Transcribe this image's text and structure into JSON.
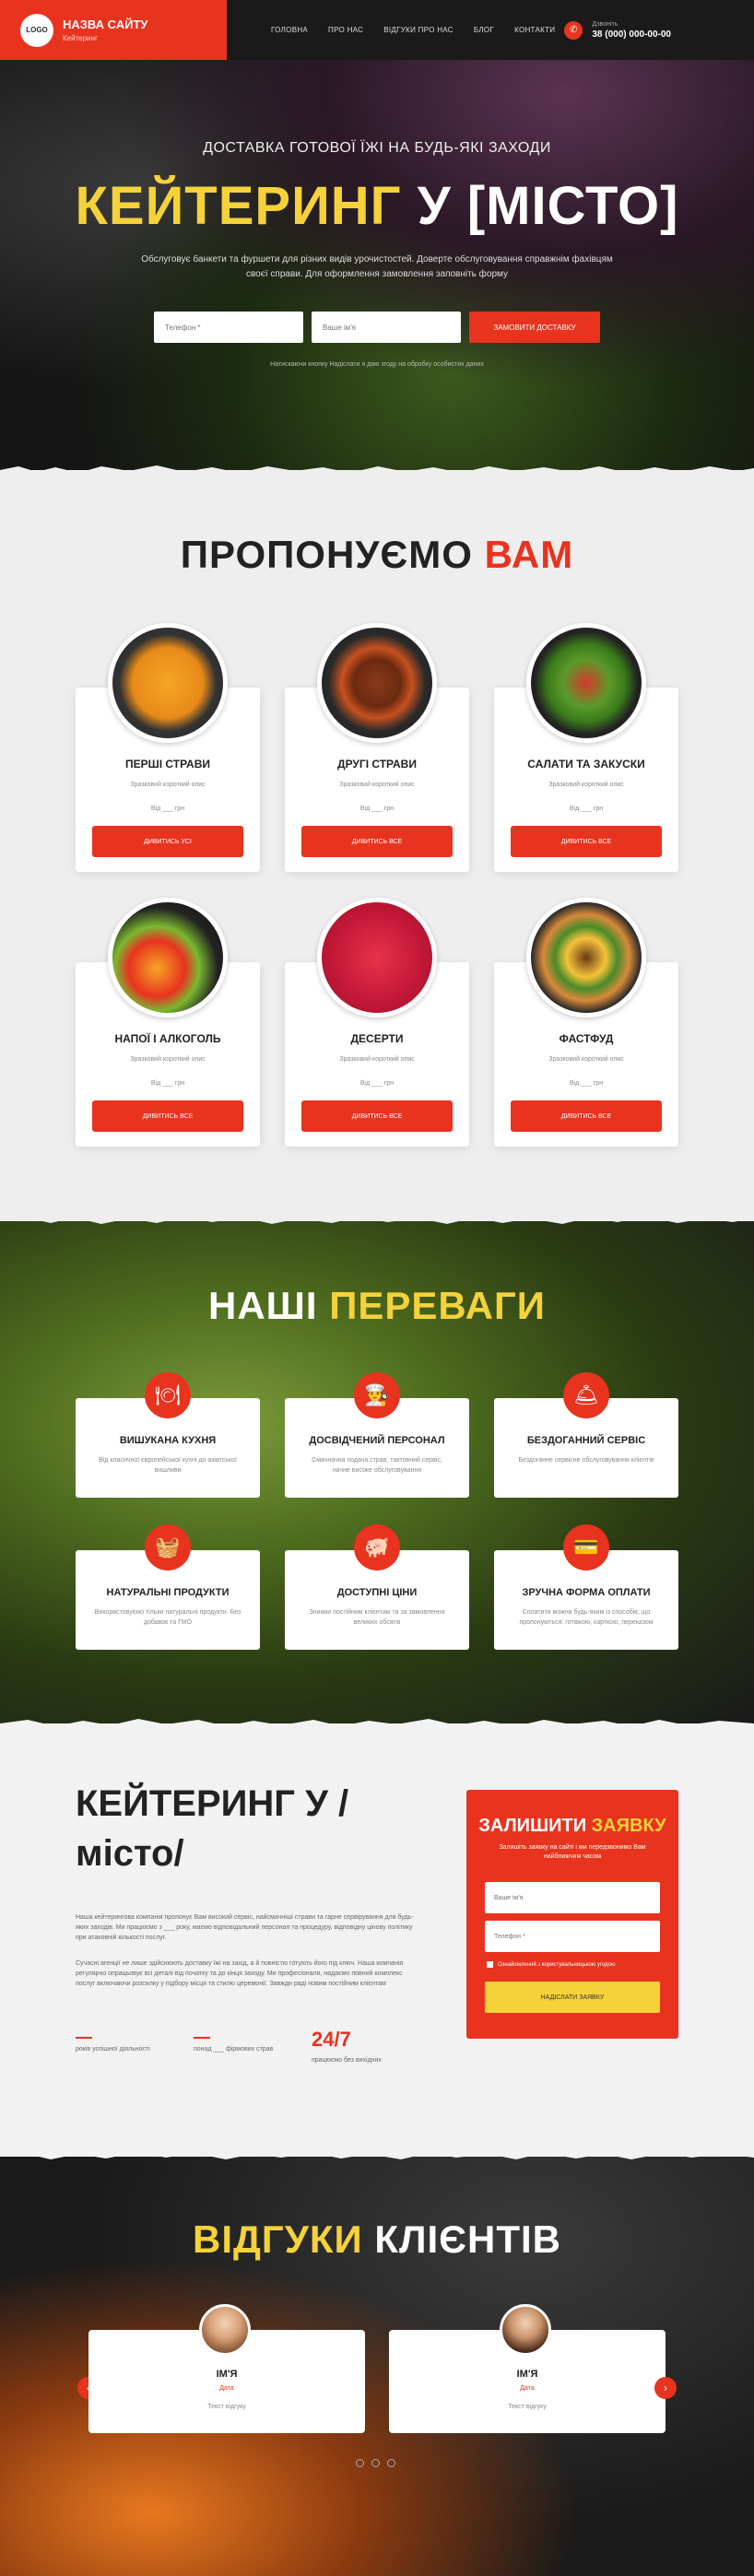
{
  "header": {
    "logo": "LOGO",
    "site_name": "НАЗВА САЙТУ",
    "site_sub": "Кейтеринг",
    "nav": [
      "ГОЛОВНА",
      "ПРО НАС",
      "ВІДГУКИ ПРО НАС",
      "БЛОГ",
      "КОНТАКТИ"
    ],
    "phone_label": "Дзвоніть",
    "phone": "38 (000) 000-00-00"
  },
  "hero": {
    "subtitle": "ДОСТАВКА ГОТОВОЇ ЇЖІ НА БУДЬ-ЯКІ ЗАХОДИ",
    "title_a": "КЕЙТЕРИНГ",
    "title_b": "У [МІСТО]",
    "description": "Обслуговує банкети та фуршети для різних видів урочистостей. Доверте обслуговування справжнім фахівцям своєї справи. Для оформлення замовлення заповніть форму",
    "phone_placeholder": "Телефон *",
    "name_placeholder": "Ваше ім'я",
    "button": "ЗАМОВИТИ ДОСТАВКУ",
    "note": "Натискаючи кнопку Надіслати я даю згоду на обробку особистих даних"
  },
  "offers": {
    "title_a": "ПРОПОНУЄМО",
    "title_b": "ВАМ",
    "items": [
      {
        "title": "ПЕРШІ СТРАВИ",
        "desc": "Зразковий короткий опис",
        "price": "Від ___ грн",
        "button": "ДИВИТИСЬ УСІ"
      },
      {
        "title": "ДРУГІ СТРАВИ",
        "desc": "Зразковий короткий опис",
        "price": "Від ___ грн",
        "button": "ДИВИТИСЬ ВСЕ"
      },
      {
        "title": "САЛАТИ ТА ЗАКУСКИ",
        "desc": "Зразковий короткий опис",
        "price": "Від ___ грн",
        "button": "ДИВИТИСЬ ВСЕ"
      },
      {
        "title": "НАПОЇ І АЛКОГОЛЬ",
        "desc": "Зразковий короткий опис",
        "price": "Від ___ грн",
        "button": "ДИВИТИСЬ ВСЕ"
      },
      {
        "title": "ДЕСЕРТИ",
        "desc": "Зразковий короткий опис",
        "price": "Від ___ грн",
        "button": "ДИВИТИСЬ ВСЕ"
      },
      {
        "title": "ФАСТФУД",
        "desc": "Зразковий короткий опис",
        "price": "Від ___ грн",
        "button": "ДИВИТИСЬ ВСЕ"
      }
    ]
  },
  "advantages": {
    "title_a": "НАШІ",
    "title_b": "ПЕРЕВАГИ",
    "items": [
      {
        "icon": "🍽",
        "title": "ВИШУКАНА КУХНЯ",
        "desc": "Від класичної європейської кухні до азіатської вишливи"
      },
      {
        "icon": "👨‍🍳",
        "title": "ДОСВІДЧЕНИЙ ПЕРСОНАЛ",
        "desc": "Смачначна подача страв, тактовний сервіс, начне високе обслуговування"
      },
      {
        "icon": "🛎",
        "title": "БЕЗДОГАННИЙ СЕРВІС",
        "desc": "Бездоганне сервісне обслуговування клієнтів"
      },
      {
        "icon": "🧺",
        "title": "НАТУРАЛЬНІ ПРОДУКТИ",
        "desc": "Використовуємо тільки натуральні продукти. Без добавок та ГМО"
      },
      {
        "icon": "🐖",
        "title": "ДОСТУПНІ ЦІНИ",
        "desc": "Знижки постійним клієнтам та за замовлення великих обсягів"
      },
      {
        "icon": "💳",
        "title": "ЗРУЧНА ФОРМА ОПЛАТИ",
        "desc": "Сплатити можна будь-яким із способів, що пропонуються: готівкою, карткою, переказом"
      }
    ]
  },
  "about": {
    "title_line1": "КЕЙТЕРИНГ У /",
    "title_line2": "місто/",
    "text1": "Наша кейтерингова компанія пропонує Вам високий сервіс, найсмачніші страви та гарне сервірування для будь-яких заходів. Ми працюємо з ___ року, маємо відповідальний персонал та процедуру, відповідну цінову політику при атаковній кількості послуг.",
    "text2": "Сучасні агенції не лише здійснюють доставку їжі на захід, а й повністю готують його під ключ. Наша компанія регулярно опрацьовує всі деталі від початку та до кінця заходу. Ми професіонали, надаємо повний комплекс послуг включаючи розсилку у підбору місця та стилю церемонії. Завжди раді новим постійним клієнтам",
    "stats": [
      {
        "num": "",
        "label": "років успішної діяльності"
      },
      {
        "num": "",
        "label": "понад ___ фірмових страв"
      },
      {
        "num": "24/7",
        "label": "працюємо без вихідних"
      }
    ]
  },
  "request": {
    "title_a": "ЗАЛИШИТИ",
    "title_b": "ЗАЯВКУ",
    "subtitle": "Залишіть заявку на сайті і ми передзвонимо Вам найближчим часом",
    "name_placeholder": "Ваше ім'я",
    "phone_placeholder": "Телефон *",
    "agree": "Ознайомлений з користувальницькою угодою",
    "button": "НАДІСЛАТИ ЗАЯВКУ"
  },
  "reviews": {
    "title_a": "ВІДГУКИ",
    "title_b": "КЛІЄНТІВ",
    "items": [
      {
        "name": "ІМ'Я",
        "date": "Дата",
        "text": "Текст відгуку"
      },
      {
        "name": "ІМ'Я",
        "date": "Дата",
        "text": "Текст відгуку"
      }
    ]
  },
  "colors": {
    "accent": "#e8331f",
    "yellow": "#f5d23a"
  }
}
